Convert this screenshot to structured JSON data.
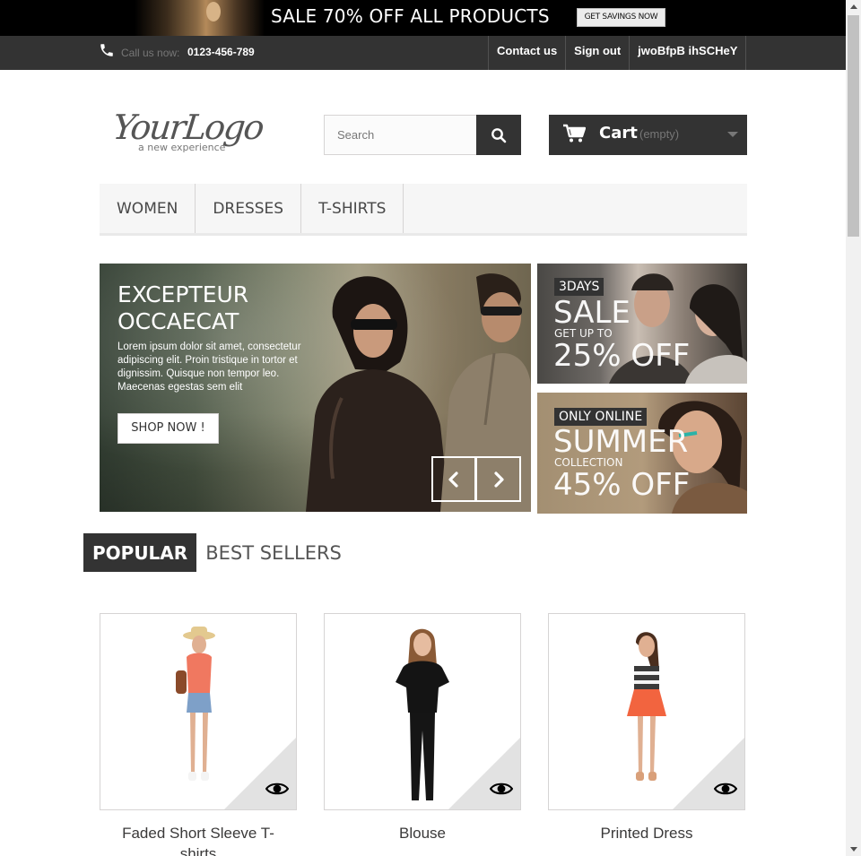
{
  "promo_banner": {
    "text": "SALE 70% OFF ALL PRODUCTS",
    "button_label": "GET SAVINGS NOW"
  },
  "top_nav": {
    "call_label": "Call us now:",
    "phone": "0123-456-789",
    "links": [
      "Contact us",
      "Sign out",
      "jwoBfpB ihSCHeY"
    ]
  },
  "header": {
    "logo_main": "YourLogo",
    "logo_sub": "a new experience",
    "search_placeholder": "Search",
    "cart_label": "Cart",
    "cart_status": "(empty)"
  },
  "menu": [
    "WOMEN",
    "DRESSES",
    "T-SHIRTS"
  ],
  "slider": {
    "title": "EXCEPTEUR OCCAECAT",
    "text": "Lorem ipsum dolor sit amet, consectetur adipiscing elit. Proin tristique in tortor et dignissim. Quisque non tempor leo. Maecenas egestas sem elit",
    "button": "SHOP NOW !"
  },
  "promo_tiles": [
    {
      "tag": "3DAYS",
      "big1": "SALE",
      "small": "GET UP TO",
      "big2": "25% OFF"
    },
    {
      "tag": "ONLY ONLINE",
      "big1": "SUMMER",
      "small": "COLLECTION",
      "big2": "45% OFF"
    }
  ],
  "tabs": [
    "POPULAR",
    "BEST SELLERS"
  ],
  "products": [
    {
      "name": "Faded Short Sleeve T-shirts"
    },
    {
      "name": "Blouse"
    },
    {
      "name": "Printed Dress"
    }
  ],
  "colors": {
    "dark_bar": "#333333",
    "promo_bg": "#000000",
    "menu_bg": "#f6f6f6",
    "border": "#d6d4d4"
  },
  "icons": [
    "phone-icon",
    "search-icon",
    "cart-icon",
    "caret-down-icon",
    "chevron-left-icon",
    "chevron-right-icon",
    "eye-icon"
  ]
}
